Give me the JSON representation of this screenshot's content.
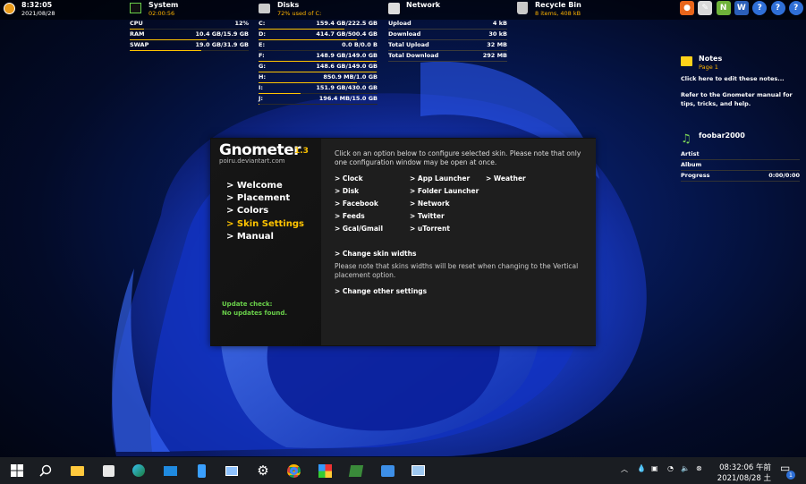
{
  "top": {
    "clock": {
      "time": "8:32:05",
      "date": "2021/08/28"
    },
    "system": {
      "title": "System",
      "uptime": "02:00:56",
      "rows": [
        {
          "label": "CPU",
          "value": "12%",
          "fill": 0.12
        },
        {
          "label": "RAM",
          "value": "10.4 GB/15.9 GB",
          "fill": 0.65
        },
        {
          "label": "SWAP",
          "value": "19.0 GB/31.9 GB",
          "fill": 0.6
        }
      ]
    },
    "disks": {
      "title": "Disks",
      "subtitle": "72% used of C:",
      "rows": [
        {
          "label": "C:",
          "value": "159.4 GB/222.5 GB",
          "fill": 0.72
        },
        {
          "label": "D:",
          "value": "414.7 GB/500.4 GB",
          "fill": 0.83
        },
        {
          "label": "E:",
          "value": "0.0 B/0.0 B",
          "fill": 0.0
        },
        {
          "label": "F:",
          "value": "148.9 GB/149.0 GB",
          "fill": 0.99
        },
        {
          "label": "G:",
          "value": "148.6 GB/149.0 GB",
          "fill": 0.99
        },
        {
          "label": "H:",
          "value": "850.9 MB/1.0 GB",
          "fill": 0.83
        },
        {
          "label": "I:",
          "value": "151.9 GB/430.0 GB",
          "fill": 0.35
        },
        {
          "label": "J:",
          "value": "196.4 MB/15.0 GB",
          "fill": 0.01
        }
      ]
    },
    "network": {
      "title": "Network",
      "rows": [
        {
          "label": "Upload",
          "value": "4 kB"
        },
        {
          "label": "Download",
          "value": "30 kB"
        },
        {
          "label": "Total Upload",
          "value": "32 MB"
        },
        {
          "label": "Total Download",
          "value": "292 MB"
        }
      ]
    },
    "recycle": {
      "title": "Recycle Bin",
      "subtitle": "8  items, 408 kB"
    },
    "launchers": [
      {
        "name": "firefox-icon",
        "glyph": "●",
        "color": "#e8651b"
      },
      {
        "name": "notepad-icon",
        "glyph": "✎",
        "color": "#d9d9d9"
      },
      {
        "name": "notepadpp-icon",
        "glyph": "N",
        "color": "#6fb33a"
      },
      {
        "name": "word-icon",
        "glyph": "W",
        "color": "#2b5fb8"
      },
      {
        "name": "help-icon",
        "glyph": "?",
        "color": "#2f6fd6"
      },
      {
        "name": "help-icon",
        "glyph": "?",
        "color": "#2f6fd6"
      },
      {
        "name": "help-icon",
        "glyph": "?",
        "color": "#2f6fd6"
      }
    ]
  },
  "notes": {
    "title": "Notes",
    "page": "Page 1",
    "line1": "Click here to edit these notes...",
    "line2": "Refer to the Gnometer manual for tips, tricks, and help."
  },
  "foobar": {
    "title": "foobar2000",
    "rows": [
      {
        "label": "Artist",
        "value": ""
      },
      {
        "label": "Album",
        "value": ""
      },
      {
        "label": "Progress",
        "value": "0:00/0:00"
      }
    ]
  },
  "dialog": {
    "brand": "Gnometer",
    "version": "1.3",
    "site": "poiru.deviantart.com",
    "nav": [
      "> Welcome",
      "> Placement",
      "> Colors",
      "> Skin Settings",
      "> Manual"
    ],
    "active_index": 3,
    "update_title": "Update check:",
    "update_status": "No updates found.",
    "intro": "Click on an option below to configure selected skin. Please note that only one configuration window may be open at once.",
    "col1": [
      "> Clock",
      "> Disk",
      "> Facebook",
      "> Feeds",
      "> Gcal/Gmail"
    ],
    "col2": [
      "> App Launcher",
      "> Folder Launcher",
      "> Network",
      "> Twitter",
      "> uTorrent"
    ],
    "col3": [
      "> Weather"
    ],
    "change_widths": "> Change skin widths",
    "note": "Please note that skins widths will be reset when changing to the Vertical placement option.",
    "change_other": "> Change other settings"
  },
  "taskbar": {
    "time": "08:32:06 午前",
    "date": "2021/08/28 土",
    "notification_count": "1"
  }
}
